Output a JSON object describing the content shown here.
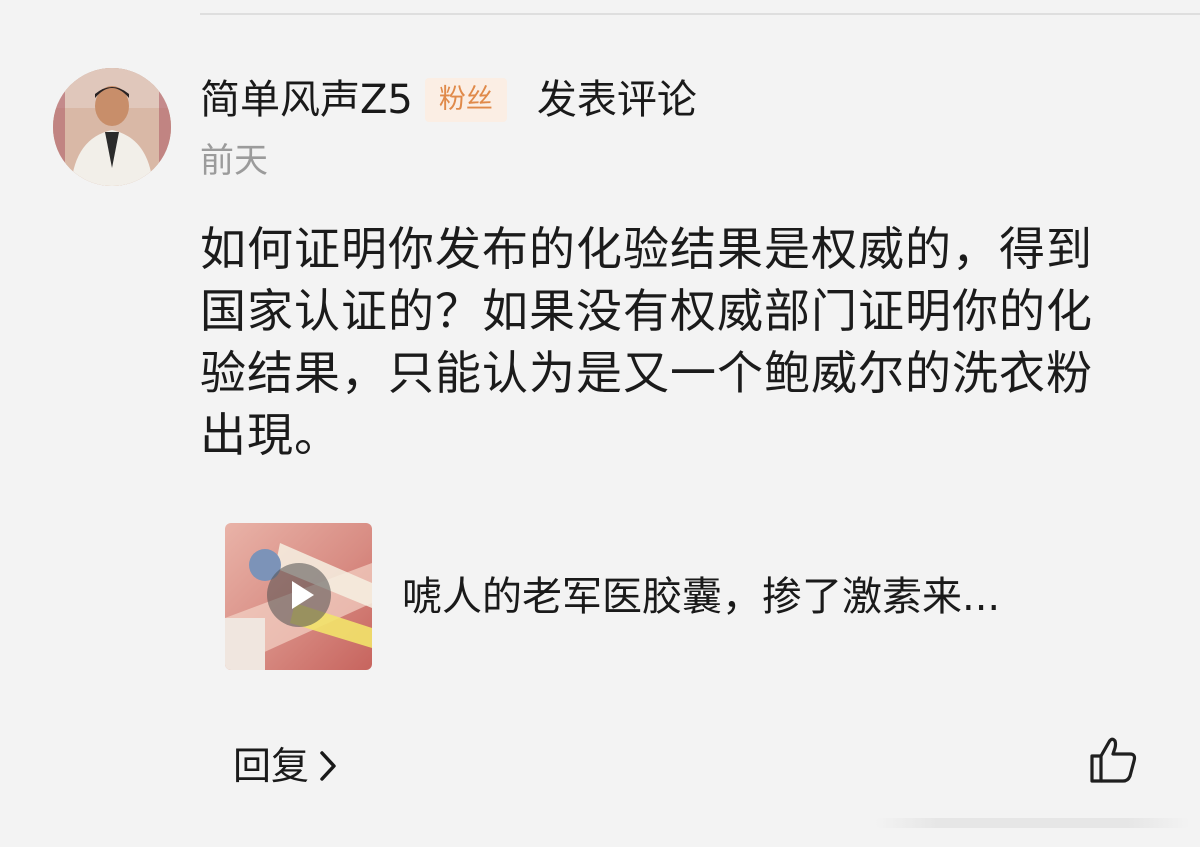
{
  "comment": {
    "user": {
      "name": "简单风声Z5",
      "badge": "粉丝",
      "action": "发表评论"
    },
    "timestamp": "前天",
    "text": "如何证明你发布的化验结果是权威的，得到国家认证的？如果没有权威部门证明你的化验结果，只能认为是又一个鲍威尔的洗衣粉出現。",
    "link_card": {
      "title": "唬人的老军医胶囊，掺了激素来...",
      "thumbnail_icon": "video-thumbnail-icon",
      "play_icon": "play-icon"
    },
    "reply_label": "回复",
    "reply_icon": "chevron-right-icon",
    "like_icon": "thumbs-up-icon"
  },
  "colors": {
    "background": "#f3f3f3",
    "badge_text": "#e08a4a",
    "badge_bg": "#fbeee4",
    "timestamp": "#9b9b9b"
  }
}
